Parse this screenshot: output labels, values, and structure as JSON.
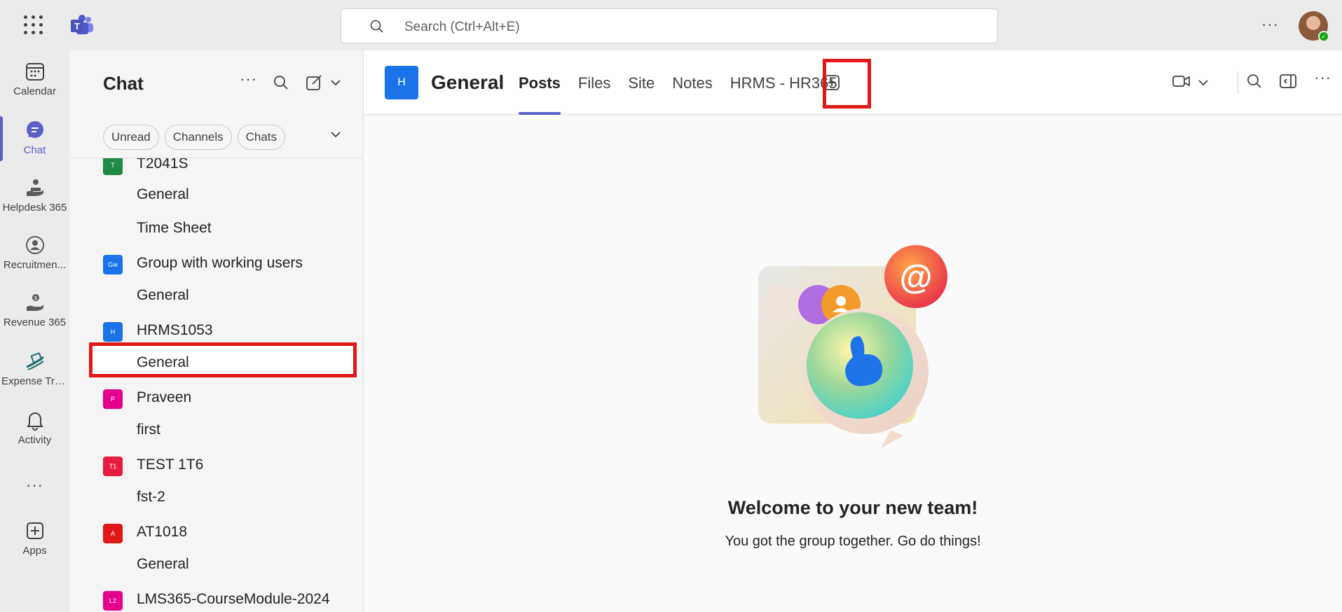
{
  "search": {
    "placeholder": "Search (Ctrl+Alt+E)"
  },
  "rail": [
    {
      "label": "Calendar",
      "icon": "calendar-icon"
    },
    {
      "label": "Chat",
      "icon": "chat-icon",
      "active": true
    },
    {
      "label": "Helpdesk 365",
      "icon": "helpdesk-icon"
    },
    {
      "label": "Recruitmen...",
      "icon": "recruitment-icon"
    },
    {
      "label": "Revenue 365",
      "icon": "revenue-icon"
    },
    {
      "label": "Expense Tra...",
      "icon": "expense-icon"
    },
    {
      "label": "Activity",
      "icon": "bell-icon"
    },
    {
      "label": "Apps",
      "icon": "apps-icon"
    }
  ],
  "pane": {
    "title": "Chat",
    "filters": [
      "Unread",
      "Channels",
      "Chats"
    ]
  },
  "list": [
    {
      "type": "team",
      "name": "T2041S",
      "initials": "T",
      "color": "#1e8a44"
    },
    {
      "type": "channel",
      "name": "General"
    },
    {
      "type": "channel",
      "name": "Time Sheet"
    },
    {
      "type": "team",
      "name": "Group with working users",
      "initials": "Gw",
      "color": "#1a73e8"
    },
    {
      "type": "channel",
      "name": "General"
    },
    {
      "type": "team",
      "name": "HRMS1053",
      "initials": "H",
      "color": "#1a73e8"
    },
    {
      "type": "channel",
      "name": "General",
      "selected": true
    },
    {
      "type": "team",
      "name": "Praveen",
      "initials": "P",
      "color": "#e3008c"
    },
    {
      "type": "channel",
      "name": "first"
    },
    {
      "type": "team",
      "name": "TEST 1T6",
      "initials": "T1",
      "color": "#e81b3f"
    },
    {
      "type": "channel",
      "name": "fst-2"
    },
    {
      "type": "team",
      "name": "AT1018",
      "initials": "A",
      "color": "#e01818"
    },
    {
      "type": "channel",
      "name": "General"
    },
    {
      "type": "team",
      "name": "LMS365-CourseModule-2024",
      "initials": "L2",
      "color": "#e3008c"
    }
  ],
  "header": {
    "team_initial": "H",
    "channel_title": "General",
    "tabs": [
      "Posts",
      "Files",
      "Site",
      "Notes",
      "HRMS - HR365"
    ],
    "active_tab": "Posts"
  },
  "welcome": {
    "title": "Welcome to your new team!",
    "subtitle": "You got the group together. Go do things!"
  },
  "colors": {
    "accent": "#5b5fc7",
    "highlight": "#e01818"
  }
}
